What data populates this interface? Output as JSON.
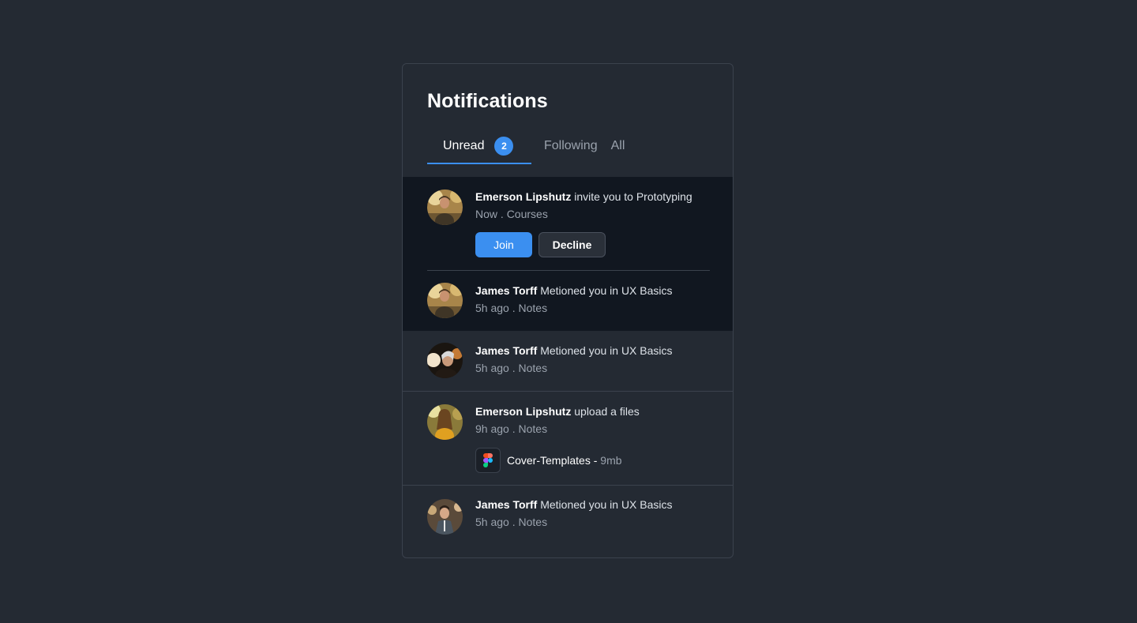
{
  "panel": {
    "title": "Notifications",
    "tabs": [
      {
        "label": "Unread",
        "badge": "2",
        "active": true
      },
      {
        "label": "Following"
      },
      {
        "label": "All"
      }
    ]
  },
  "notifications": [
    {
      "name": "Emerson Lipshutz",
      "action": " invite you to Prototyping",
      "time": "Now",
      "separator": " . ",
      "category": "Courses",
      "unread": true,
      "buttons": {
        "join": "Join",
        "decline": "Decline"
      }
    },
    {
      "name": "James Torff",
      "action": " Metioned you in UX Basics",
      "time": "5h ago",
      "separator": " . ",
      "category": "Notes",
      "unread": true
    },
    {
      "name": "James Torff",
      "action": " Metioned you in UX Basics",
      "time": "5h ago",
      "separator": " . ",
      "category": "Notes",
      "unread": false
    },
    {
      "name": "Emerson Lipshutz",
      "action": " upload a files",
      "time": "9h ago",
      "separator": " . ",
      "category": "Notes",
      "unread": false,
      "file": {
        "name": "Cover-Templates",
        "dash": " - ",
        "size": "9mb",
        "icon": "figma-icon"
      }
    },
    {
      "name": "James Torff",
      "action": " Metioned you in UX Basics",
      "time": "5h ago",
      "separator": " . ",
      "category": "Notes",
      "unread": false
    }
  ],
  "colors": {
    "background": "#242a33",
    "unread_background": "#111720",
    "accent": "#3b8ff0",
    "border": "#3b424d"
  }
}
